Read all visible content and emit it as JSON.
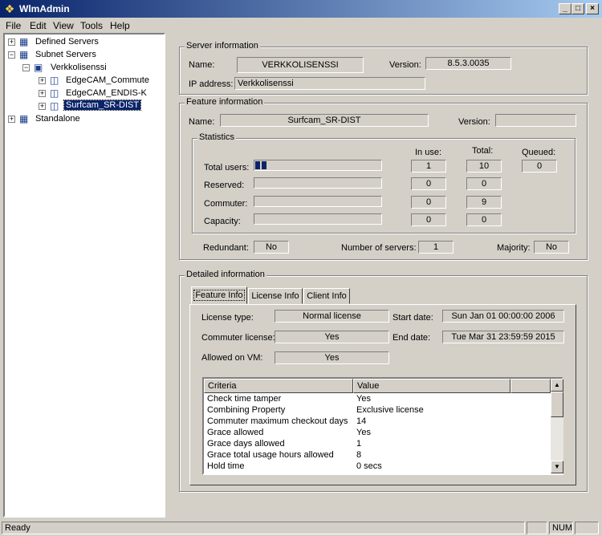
{
  "window": {
    "title": "WlmAdmin"
  },
  "menu": [
    "File",
    "Edit",
    "View",
    "Tools",
    "Help"
  ],
  "tree": {
    "defined_servers": "Defined Servers",
    "subnet_servers": "Subnet Servers",
    "server_node": "Verkkolisenssi",
    "features": [
      "EdgeCAM_Commute",
      "EdgeCAM_ENDIS-K",
      "Surfcam_SR-DIST"
    ],
    "standalone": "Standalone"
  },
  "server_info": {
    "group_title": "Server information",
    "name_label": "Name:",
    "name_value": "VERKKOLISENSSI",
    "version_label": "Version:",
    "version_value": "8.5.3.0035",
    "ip_label": "IP address:",
    "ip_value": "Verkkolisenssi"
  },
  "feature_info": {
    "group_title": "Feature information",
    "name_label": "Name:",
    "name_value": "Surfcam_SR-DIST",
    "version_label": "Version:",
    "version_value": ""
  },
  "statistics": {
    "group_title": "Statistics",
    "col_in_use": "In use:",
    "col_total": "Total:",
    "col_queued": "Queued:",
    "rows": [
      {
        "label": "Total users:",
        "in_use": "1",
        "total": "10",
        "queued": "0",
        "fraction": 0.1
      },
      {
        "label": "Reserved:",
        "in_use": "0",
        "total": "0",
        "fraction": 0
      },
      {
        "label": "Commuter:",
        "in_use": "0",
        "total": "9",
        "fraction": 0
      },
      {
        "label": "Capacity:",
        "in_use": "0",
        "total": "0",
        "fraction": 0
      }
    ],
    "redundant_label": "Redundant:",
    "redundant_value": "No",
    "servers_label": "Number of servers:",
    "servers_value": "1",
    "majority_label": "Majority:",
    "majority_value": "No"
  },
  "detailed": {
    "group_title": "Detailed information",
    "tabs": [
      "Feature Info",
      "License Info",
      "Client Info"
    ],
    "license_type_label": "License type:",
    "license_type_value": "Normal license",
    "start_date_label": "Start date:",
    "start_date_value": "Sun Jan 01 00:00:00 2006",
    "commuter_label": "Commuter license:",
    "commuter_value": "Yes",
    "end_date_label": "End date:",
    "end_date_value": "Tue Mar 31 23:59:59 2015",
    "vm_label": "Allowed on VM:",
    "vm_value": "Yes",
    "table": {
      "col_criteria": "Criteria",
      "col_value": "Value",
      "rows": [
        {
          "criteria": "Check time tamper",
          "value": "Yes"
        },
        {
          "criteria": "Combining Property",
          "value": "Exclusive license"
        },
        {
          "criteria": "Commuter maximum checkout days",
          "value": "14"
        },
        {
          "criteria": "Grace allowed",
          "value": "Yes"
        },
        {
          "criteria": "Grace days allowed",
          "value": "1"
        },
        {
          "criteria": "Grace total usage hours allowed",
          "value": "8"
        },
        {
          "criteria": "Hold time",
          "value": "0 secs"
        }
      ]
    }
  },
  "statusbar": {
    "text": "Ready",
    "num": "NUM"
  }
}
